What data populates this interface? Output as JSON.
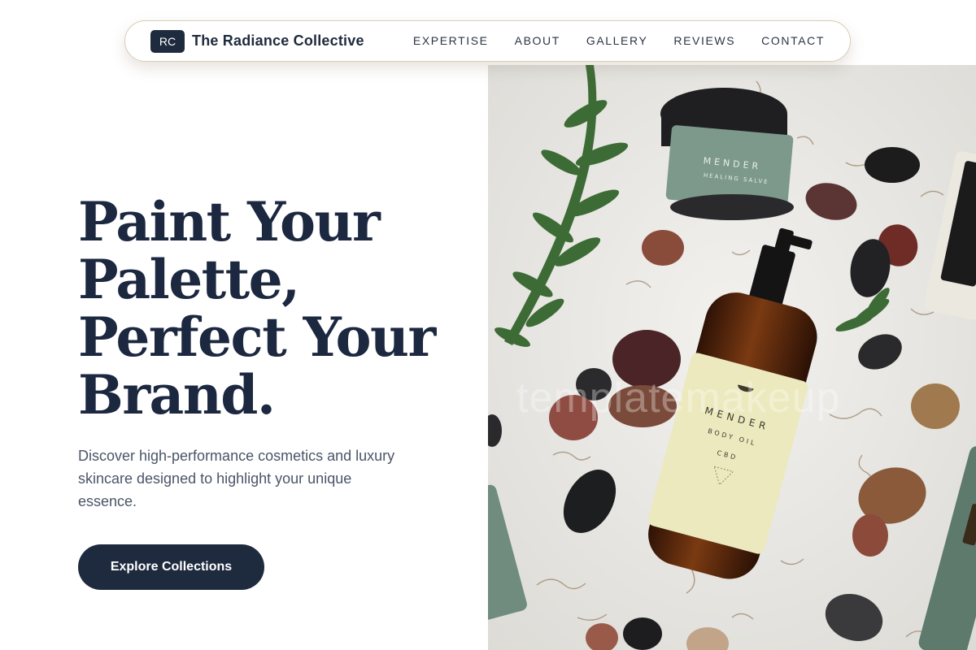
{
  "brand": {
    "logo_initials": "RC",
    "name": "The Radiance Collective"
  },
  "nav": {
    "links": [
      "EXPERTISE",
      "ABOUT",
      "GALLERY",
      "REVIEWS",
      "CONTACT"
    ]
  },
  "hero": {
    "headline_lines": [
      "Paint Your",
      "Palette,",
      "Perfect Your",
      "Brand."
    ],
    "subtitle": "Discover high-performance cosmetics and luxury skincare designed to highlight your unique essence.",
    "cta_label": "Explore Collections"
  },
  "image": {
    "watermark": "templatemakeup",
    "jar_brand": "MENDER",
    "jar_label": "HEALING SALVE",
    "bottle_brand": "MENDER",
    "bottle_label": "BODY OIL",
    "bottle_sub": "CBD"
  },
  "colors": {
    "primary": "#1e2a3d",
    "nav_border": "#d9ccb4",
    "text_muted": "#4a5568",
    "sage": "#7c978a",
    "cream_label": "#ece9bf",
    "amber": "#5b2a10"
  }
}
